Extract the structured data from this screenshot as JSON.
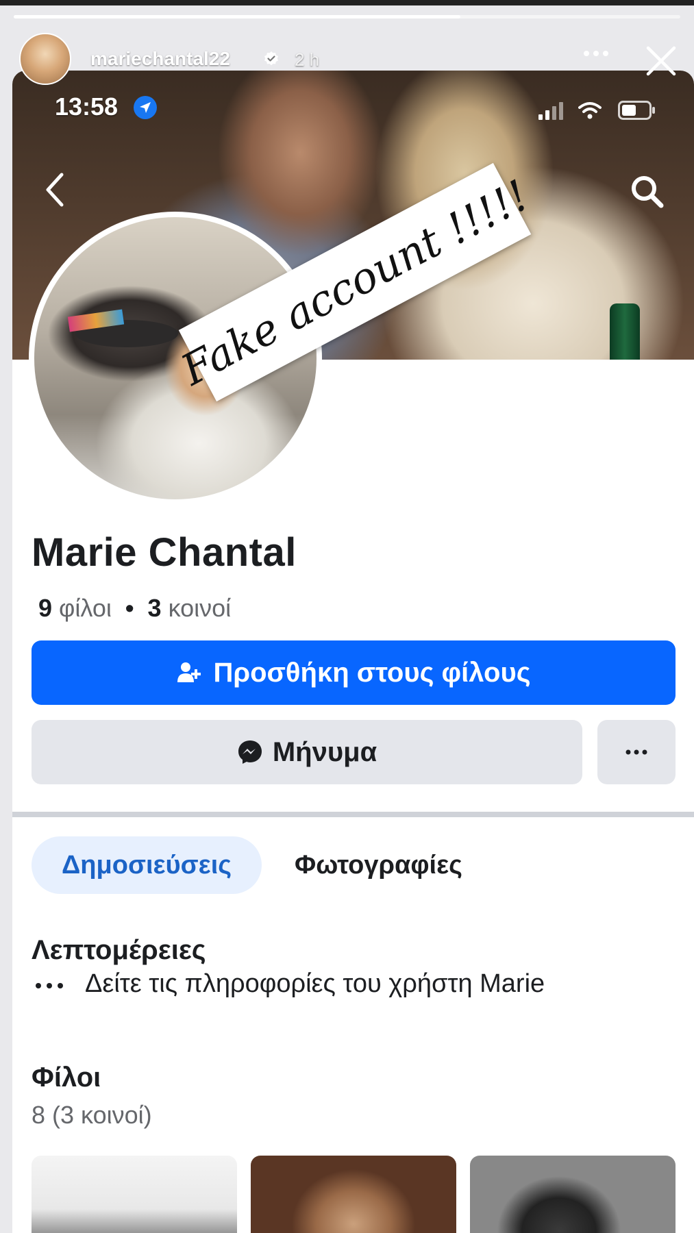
{
  "story": {
    "username": "mariechantal22",
    "time": "2 h",
    "progress": 0.67
  },
  "phone": {
    "time": "13:58"
  },
  "overlay": {
    "text": "Fake account !!!!!"
  },
  "profile": {
    "name": "Marie Chantal",
    "friends_count": "9",
    "friends_label": "φίλοι",
    "separator": "•",
    "mutual_count": "3",
    "mutual_label": "κοινοί"
  },
  "actions": {
    "add_friend": "Προσθήκη στους φίλους",
    "message": "Μήνυμα"
  },
  "tabs": {
    "posts": "Δημοσιεύσεις",
    "photos": "Φωτογραφίες"
  },
  "details": {
    "title": "Λεπτομέρειες",
    "text": "Δείτε τις πληροφορίες του χρήστη Marie"
  },
  "friends": {
    "title": "Φίλοι",
    "count": "8 (3 κοινοί)"
  },
  "colors": {
    "primary_button": "#0866ff",
    "secondary_button": "#e4e6eb",
    "active_tab_bg": "#e7f0fe",
    "active_tab_text": "#1b63c6"
  },
  "icons": [
    "verified-icon",
    "more-icon",
    "close-icon",
    "location-icon",
    "signal-icon",
    "wifi-icon",
    "battery-icon",
    "back-icon",
    "search-icon",
    "add-friend-icon",
    "messenger-icon",
    "ellipsis-icon"
  ]
}
